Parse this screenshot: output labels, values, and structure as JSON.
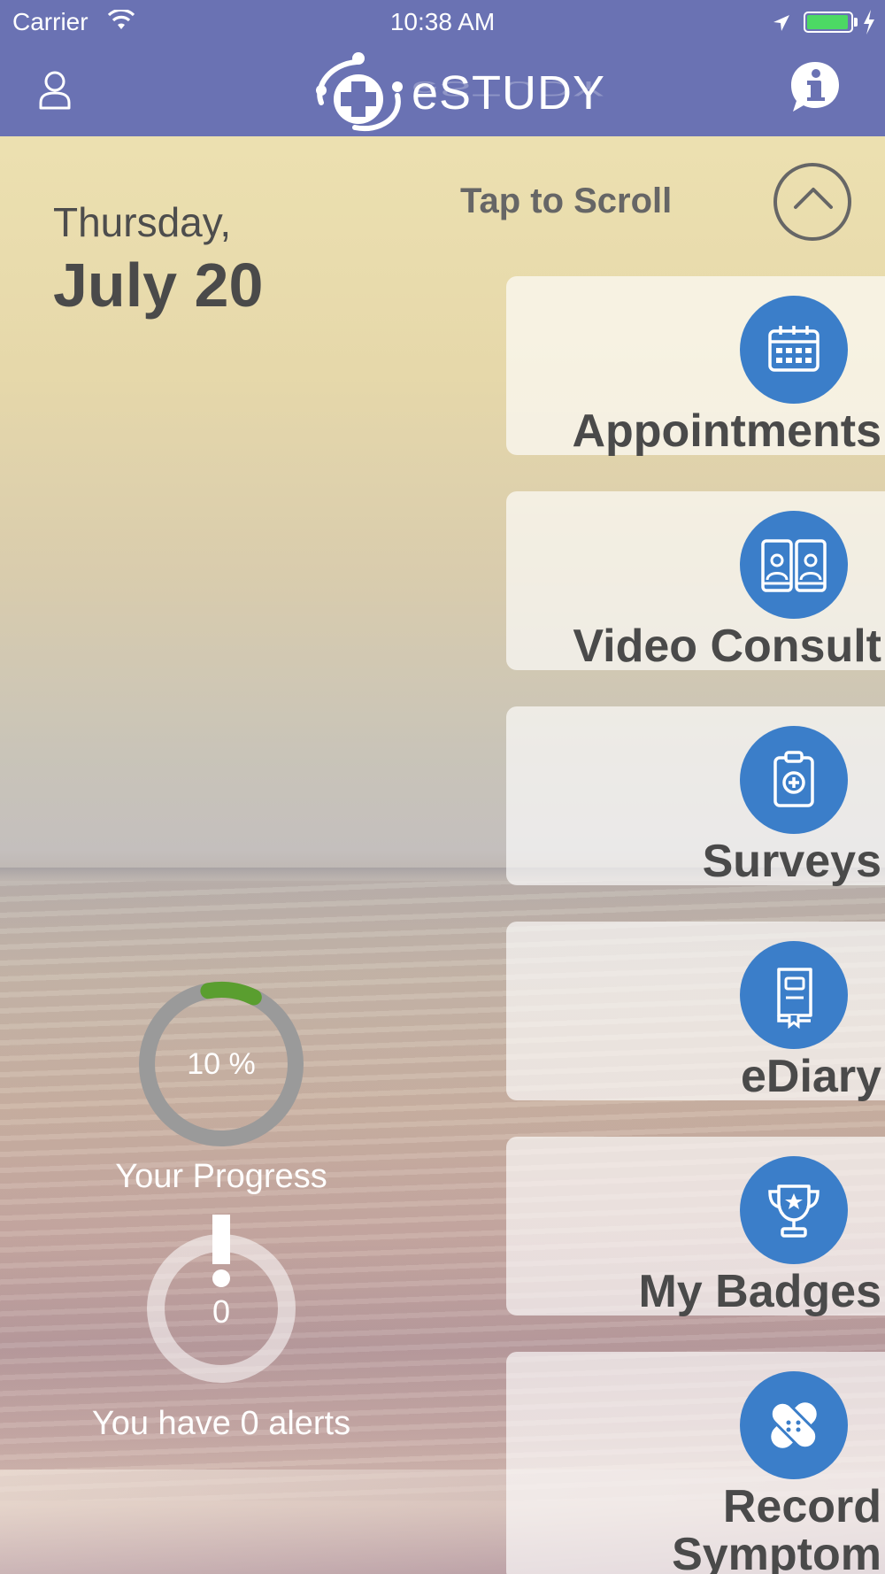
{
  "status_bar": {
    "carrier": "Carrier",
    "time": "10:38 AM",
    "battery_color": "#4cd964"
  },
  "nav": {
    "logo_text": "eSTUDY",
    "left_icon": "user-icon",
    "right_icon": "info-icon",
    "bar_color": "#6a72b3"
  },
  "date": {
    "weekday": "Thursday,",
    "day": "July 20"
  },
  "scroll": {
    "label": "Tap to Scroll",
    "icon": "chevron-up-icon"
  },
  "menu": [
    {
      "label": "Appointments",
      "icon": "calendar-icon"
    },
    {
      "label": "Video Consult",
      "icon": "video-consult-icon"
    },
    {
      "label": "Surveys",
      "icon": "clipboard-icon"
    },
    {
      "label": "eDiary",
      "icon": "diary-book-icon"
    },
    {
      "label": "My Badges",
      "icon": "trophy-icon"
    },
    {
      "label": "Record Symptom",
      "icon": "bandage-icon"
    }
  ],
  "accent_color": "#3b7ec9",
  "progress": {
    "value": "10 %",
    "fraction": 0.1,
    "label": "Your Progress",
    "color": "#5a9e2f"
  },
  "alerts": {
    "count": "0",
    "label": "You have 0 alerts"
  }
}
